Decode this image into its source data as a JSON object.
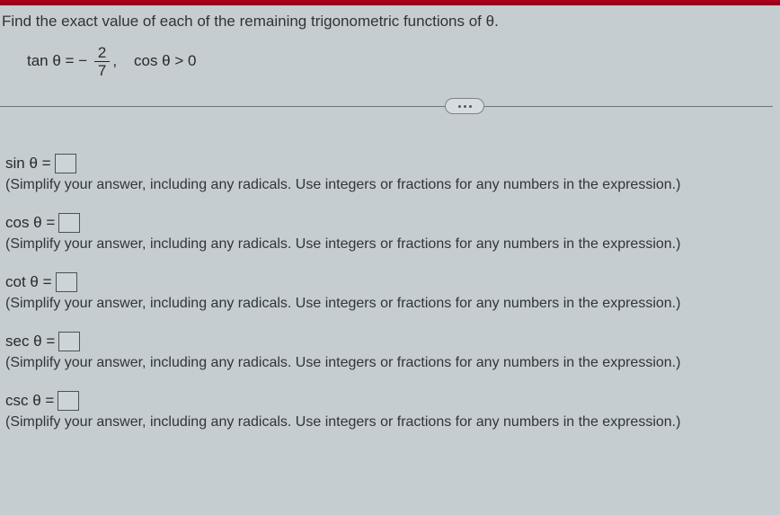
{
  "prompt": "Find the exact value of each of the remaining trigonometric functions of θ.",
  "given": {
    "lhs": "tan θ =",
    "neg": "−",
    "num": "2",
    "den": "7",
    "comma": ",",
    "cond": "cos θ > 0"
  },
  "pill": "...",
  "hint_text": "(Simplify your answer, including any radicals. Use integers or fractions for any numbers in the expression.)",
  "rows": [
    {
      "label": "sin θ ="
    },
    {
      "label": "cos θ ="
    },
    {
      "label": "cot θ ="
    },
    {
      "label": "sec θ ="
    },
    {
      "label": "csc θ ="
    }
  ]
}
